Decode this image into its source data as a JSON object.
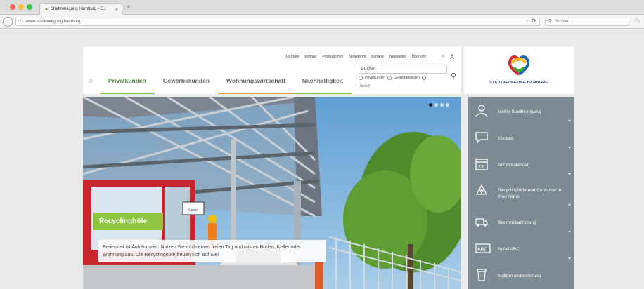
{
  "browser": {
    "tab_title": "Stadtreinigung Hamburg - E...",
    "tab_close": "×",
    "new_tab": "+",
    "url": "www.stadtreinigung.hamburg",
    "search_placeholder": "Suchen"
  },
  "header": {
    "top_links": [
      "Drucken",
      "Kontakt",
      "Publikationen",
      "Newsroom",
      "Karriere",
      "Newsletter",
      "Über uns"
    ],
    "font_small": "A",
    "font_large": "A",
    "nav": [
      "Privatkunden",
      "Gewerbekunden",
      "Wohnungswirtschaft",
      "Nachhaltigkeit"
    ],
    "search": {
      "label": "Suche",
      "option_private": "Privatkunden",
      "option_business": "Gewerbekunden",
      "extra": "Überall"
    },
    "logo_text": "STADTREINIGUNG HAMBURG"
  },
  "hero": {
    "tag": "Recyclinghöfe",
    "caption": "Ferienzeit ist Aufräumzeit: Nutzen Sie doch einen freien Tag und misten Boden, Keller oder Wohnung aus. Die Recyclinghöfe freuen sich auf Sie!",
    "sign": "Kasse"
  },
  "sidebar": {
    "items": [
      {
        "label": "Meine Stadtreinigung",
        "icon": "person-icon"
      },
      {
        "label": "Kontakt",
        "icon": "speech-bubble-icon"
      },
      {
        "label": "Abfuhrkalender",
        "icon": "calendar-icon",
        "icon_text": "23"
      },
      {
        "label": "Recyclinghöfe und Container in Ihrer Nähe",
        "icon": "recycle-icon"
      },
      {
        "label": "Sperrmüllabholung",
        "icon": "truck-icon"
      },
      {
        "label": "Abfall ABC",
        "icon": "abc-icon",
        "icon_text": "ABC"
      },
      {
        "label": "Mülltonnenbestellung",
        "icon": "trash-bin-icon"
      }
    ]
  },
  "colors": {
    "accent_green": "#8dc63f",
    "accent_orange": "#e8a33b",
    "sidebar_bg": "#7c8b93"
  }
}
